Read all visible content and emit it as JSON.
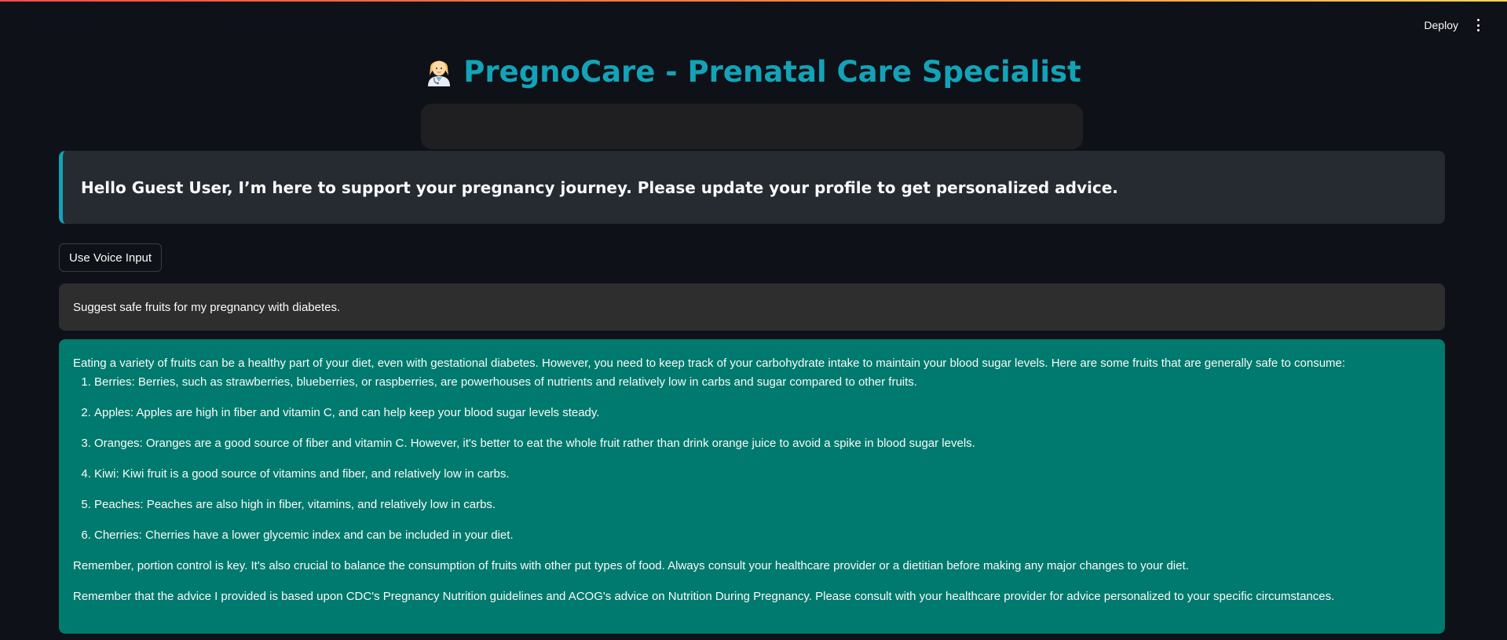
{
  "header": {
    "deploy_label": "Deploy",
    "menu_icon": "more-vertical-icon"
  },
  "title": {
    "emoji_icon": "female-health-worker-icon",
    "text": "PregnoCare - Prenatal Care Specialist",
    "color": "#13a3b8"
  },
  "greeting": {
    "text": "Hello Guest User, I’m here to support your pregnancy journey. Please update your profile to get personalized advice."
  },
  "voice_button": {
    "label": "Use Voice Input"
  },
  "chat": {
    "user_message": "Suggest safe fruits for my pregnancy with diabetes.",
    "assistant": {
      "intro": "Eating a variety of fruits can be a healthy part of your diet, even with gestational diabetes. However, you need to keep track of your carbohydrate intake to maintain your blood sugar levels. Here are some fruits that are generally safe to consume:",
      "items": [
        "Berries: Berries, such as strawberries, blueberries, or raspberries, are powerhouses of nutrients and relatively low in carbs and sugar compared to other fruits.",
        "Apples: Apples are high in fiber and vitamin C, and can help keep your blood sugar levels steady.",
        "Oranges: Oranges are a good source of fiber and vitamin C. However, it's better to eat the whole fruit rather than drink orange juice to avoid a spike in blood sugar levels.",
        "Kiwi: Kiwi fruit is a good source of vitamins and fiber, and relatively low in carbs.",
        "Peaches: Peaches are also high in fiber, vitamins, and relatively low in carbs.",
        "Cherries: Cherries have a lower glycemic index and can be included in your diet."
      ],
      "closing_1": "Remember, portion control is key. It's also crucial to balance the consumption of fruits with other put types of food. Always consult your healthcare provider or a dietitian before making any major changes to your diet.",
      "closing_2": "Remember that the advice I provided is based upon CDC's Pregnancy Nutrition guidelines and ACOG's advice on Nutrition During Pregnancy. Please consult with your healthcare provider for advice personalized to your specific circumstances."
    }
  },
  "colors": {
    "background": "#0e1117",
    "accent": "#13a3b8",
    "assistant_bubble": "#007a6e",
    "user_bubble": "#2e2e2e",
    "greeting_bg": "#262b31"
  }
}
